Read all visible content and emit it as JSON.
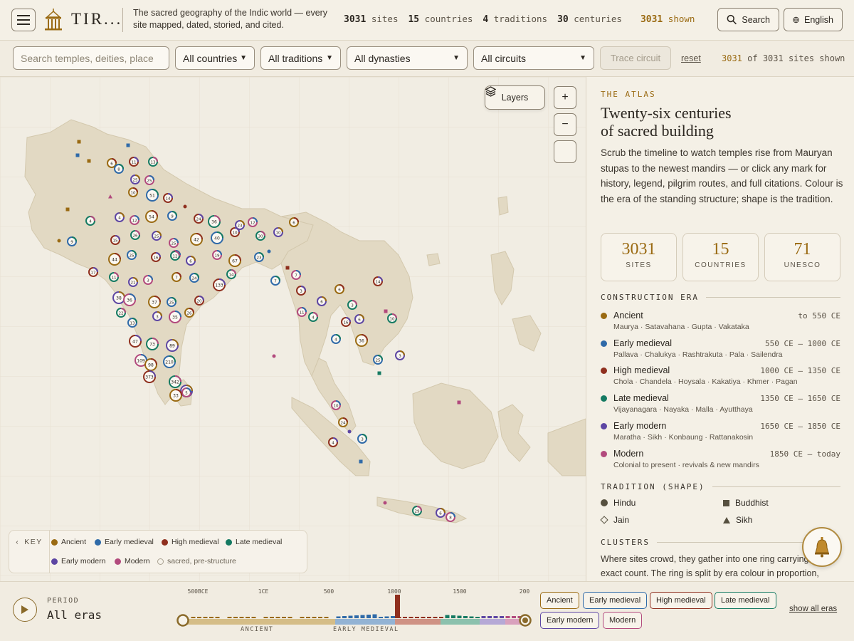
{
  "header": {
    "brand": "TIR...",
    "tagline": "The sacred geography of the Indic world — every site mapped, dated, storied, and cited.",
    "stats": [
      {
        "value": "3031",
        "label": "sites"
      },
      {
        "value": "15",
        "label": "countries"
      },
      {
        "value": "4",
        "label": "traditions"
      },
      {
        "value": "30",
        "label": "centuries"
      }
    ],
    "shown": {
      "value": "3031",
      "label": "shown"
    },
    "search_label": "Search",
    "language_label": "English"
  },
  "filters": {
    "search_placeholder": "Search temples, deities, place",
    "country": "All countries",
    "tradition": "All traditions",
    "dynasty": "All dynasties",
    "circuit": "All circuits",
    "trace_label": "Trace circuit",
    "reset_label": "reset",
    "shown_num": "3031",
    "shown_rest": "of 3031 sites shown"
  },
  "map": {
    "layers_label": "Layers",
    "zoom_in": "+",
    "zoom_out": "−",
    "key": {
      "toggle": "KEY",
      "items": [
        {
          "label": "Ancient",
          "color": "#9a6a12"
        },
        {
          "label": "Early medieval",
          "color": "#2f6aa8"
        },
        {
          "label": "High medieval",
          "color": "#8f2f1e"
        },
        {
          "label": "Late medieval",
          "color": "#157a62"
        },
        {
          "label": "Early modern",
          "color": "#5d46a3"
        },
        {
          "label": "Modern",
          "color": "#b24a7d"
        },
        {
          "label": "sacred, pre-structure",
          "color": "#bdb5a5"
        }
      ]
    },
    "cluster_counts": [
      "6",
      "8",
      "11",
      "13",
      "25",
      "25",
      "10",
      "51",
      "14",
      "4",
      "4",
      "12",
      "54",
      "9",
      "24",
      "36",
      "23",
      "12",
      "6",
      "9",
      "15",
      "26",
      "25",
      "25",
      "42",
      "40",
      "10",
      "30",
      "10",
      "12",
      "44",
      "25",
      "16",
      "12",
      "6",
      "19",
      "67",
      "23",
      "17",
      "11",
      "21",
      "3",
      "7",
      "24",
      "133",
      "14",
      "38",
      "36",
      "37",
      "25",
      "20",
      "22",
      "3",
      "35",
      "26",
      "13",
      "47",
      "73",
      "89",
      "109",
      "98",
      "210",
      "373",
      "342",
      "40",
      "5",
      "33",
      "7",
      "3",
      "4",
      "6",
      "11",
      "6",
      "4",
      "16",
      "3",
      "6",
      "7",
      "36",
      "25",
      "14",
      "10",
      "3",
      "10",
      "24",
      "3",
      "4",
      "29",
      "6",
      "8"
    ]
  },
  "side": {
    "eyebrow": "THE ATLAS",
    "title_line1": "Twenty-six centuries",
    "title_line2": "of sacred building",
    "description": "Scrub the timeline to watch temples rise from Mauryan stupas to the newest mandirs — or click any mark for history, legend, pilgrim routes, and full citations. Colour is the era of the standing structure; shape is the tradition.",
    "cards": [
      {
        "value": "3031",
        "label": "SITES"
      },
      {
        "value": "15",
        "label": "COUNTRIES"
      },
      {
        "value": "71",
        "label": "UNESCO"
      }
    ],
    "era_heading": "CONSTRUCTION ERA",
    "eras": [
      {
        "name": "Ancient",
        "range": "to 550 CE",
        "sub": "Maurya · Satavahana · Gupta · Vakataka",
        "color": "#9a6a12"
      },
      {
        "name": "Early medieval",
        "range": "550 CE – 1000 CE",
        "sub": "Pallava · Chalukya · Rashtrakuta · Pala · Sailendra",
        "color": "#2f6aa8"
      },
      {
        "name": "High medieval",
        "range": "1000 CE – 1350 CE",
        "sub": "Chola · Chandela · Hoysala · Kakatiya · Khmer · Pagan",
        "color": "#8f2f1e"
      },
      {
        "name": "Late medieval",
        "range": "1350 CE – 1650 CE",
        "sub": "Vijayanagara · Nayaka · Malla · Ayutthaya",
        "color": "#157a62"
      },
      {
        "name": "Early modern",
        "range": "1650 CE – 1850 CE",
        "sub": "Maratha · Sikh · Konbaung · Rattanakosin",
        "color": "#5d46a3"
      },
      {
        "name": "Modern",
        "range": "1850 CE – today",
        "sub": "Colonial to present · revivals & new mandirs",
        "color": "#b24a7d"
      }
    ],
    "tradition_heading": "TRADITION (SHAPE)",
    "traditions": [
      {
        "name": "Hindu",
        "shape": "circle"
      },
      {
        "name": "Buddhist",
        "shape": "square"
      },
      {
        "name": "Jain",
        "shape": "diamond"
      },
      {
        "name": "Sikh",
        "shape": "triangle"
      }
    ],
    "clusters_heading": "CLUSTERS",
    "clusters_text": "Where sites crowd, they gather into one ring carrying the exact count. The ring is split by era colour in proportion,"
  },
  "timeline": {
    "period_label": "PERIOD",
    "period_value": "All eras",
    "ticks": [
      "500BCE",
      "1CE",
      "500",
      "1000",
      "1500",
      "200"
    ],
    "era_band_labels": [
      "ANCIENT",
      "EARLY MEDIEVAL"
    ],
    "chips": [
      "Ancient",
      "Early medieval",
      "High medieval",
      "Late medieval",
      "Early modern",
      "Modern"
    ],
    "show_all": "show all eras"
  }
}
